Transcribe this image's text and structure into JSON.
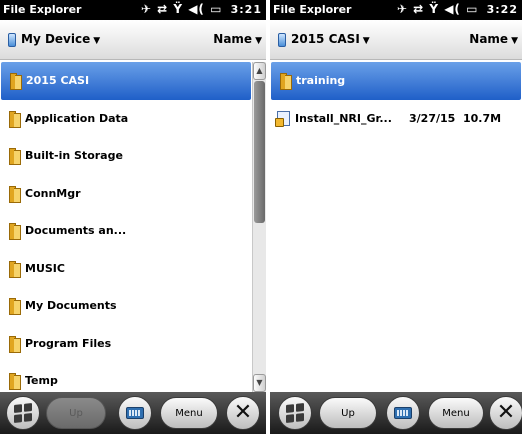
{
  "left_screen": {
    "status": {
      "app_title": "File Explorer",
      "icons": "✈ ⇄ Ϋ ◀(",
      "battery": "▭",
      "time": "3:21"
    },
    "header": {
      "location": "My Device",
      "sort": "Name"
    },
    "items": [
      {
        "label": "2015 CASI"
      },
      {
        "label": "Application Data"
      },
      {
        "label": "Built-in Storage"
      },
      {
        "label": "ConnMgr"
      },
      {
        "label": "Documents an..."
      },
      {
        "label": "MUSIC"
      },
      {
        "label": "My Documents"
      },
      {
        "label": "Program Files"
      },
      {
        "label": "Temp"
      }
    ],
    "scroll_up": "▲",
    "scroll_down": "▼",
    "taskbar": {
      "up_label": "Up",
      "menu_label": "Menu"
    }
  },
  "right_screen": {
    "status": {
      "app_title": "File Explorer",
      "icons": "✈ ⇄ Ϋ ◀(",
      "battery": "▭",
      "time": "3:22"
    },
    "header": {
      "location": "2015 CASI",
      "sort": "Name"
    },
    "folder": {
      "label": "training"
    },
    "file": {
      "name": "Install_NRI_Gr...",
      "date": "3/27/15",
      "size": "10.7M"
    },
    "taskbar": {
      "up_label": "Up",
      "menu_label": "Menu"
    }
  },
  "colors": {
    "selection": "#1f5fc8",
    "status_bar": "#000000",
    "folder": "#e0a520"
  }
}
